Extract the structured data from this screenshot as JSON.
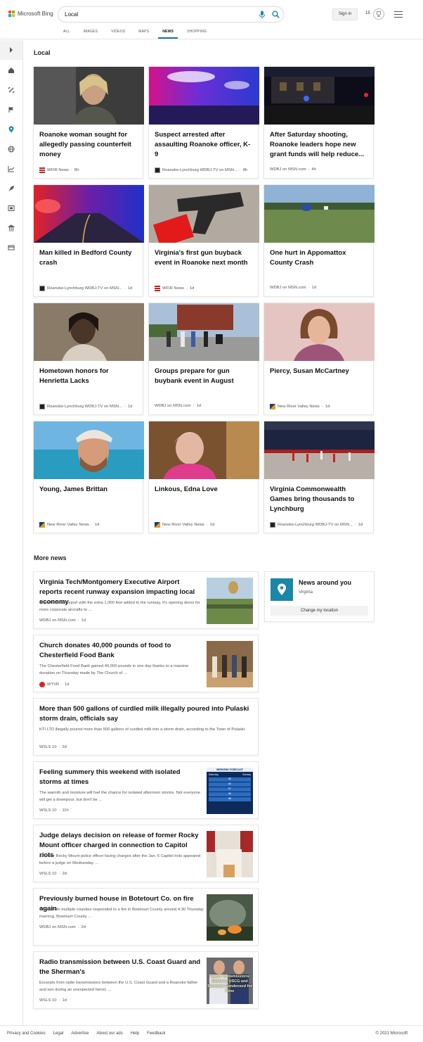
{
  "brand": {
    "name": "Microsoft Bing",
    "logo_colors": [
      "#f25022",
      "#7fba00",
      "#00a4ef",
      "#ffb900"
    ],
    "accent": "#1a87a8"
  },
  "search": {
    "query": "Local",
    "mic_icon": "microphone-icon",
    "search_icon": "magnifier-icon"
  },
  "account": {
    "signin_label": "Sign in",
    "reward_points": "15",
    "reward_icon": "trophy-icon"
  },
  "tabs": [
    {
      "label": "ALL",
      "active": false
    },
    {
      "label": "IMAGES",
      "active": false
    },
    {
      "label": "VIDEOS",
      "active": false
    },
    {
      "label": "MAPS",
      "active": false
    },
    {
      "label": "NEWS",
      "active": true
    },
    {
      "label": "SHOPPING",
      "active": false
    }
  ],
  "sidebar_icons": [
    "chevron-right-icon",
    "home-icon",
    "satellite-icon",
    "flag-icon",
    "location-pin-icon",
    "globe-icon",
    "business-chart-icon",
    "rocket-icon",
    "film-icon",
    "bank-icon",
    "credit-card-icon"
  ],
  "local": {
    "title": "Local",
    "cards": [
      {
        "title": "Roanoke woman sought for allegedly passing counterfeit money",
        "source": "WFIR News",
        "age": "8h"
      },
      {
        "title": "Suspect arrested after assaulting Roanoke officer, K-9",
        "source": "Roanoke-Lynchburg WDBJ-TV on MSN...",
        "age": "8h"
      },
      {
        "title": "After Saturday shooting, Roanoke leaders hope new grant funds will help reduce...",
        "source": "WDBJ on MSN.com",
        "age": "4h"
      },
      {
        "title": "Man killed in Bedford County crash",
        "source": "Roanoke-Lynchburg WDBJ-TV on MSN...",
        "age": "1d"
      },
      {
        "title": "Virginia's first gun buyback event in Roanoke next month",
        "source": "WFIR News",
        "age": "1d"
      },
      {
        "title": "One hurt in Appomattox County Crash",
        "source": "WDBJ on MSN.com",
        "age": "1d"
      },
      {
        "title": "Hometown honors for Henrietta Lacks",
        "source": "Roanoke-Lynchburg WDBJ-TV on MSN...",
        "age": "1d"
      },
      {
        "title": "Groups prepare for gun buybank event in August",
        "source": "WDBJ on MSN.com",
        "age": "1d"
      },
      {
        "title": "Piercy, Susan McCartney",
        "source": "New River Valley News",
        "age": "1d"
      },
      {
        "title": "Young, James Brittan",
        "source": "New River Valley News",
        "age": "1d"
      },
      {
        "title": "Linkous, Edna Love",
        "source": "New River Valley News",
        "age": "1d"
      },
      {
        "title": "Virginia Commonwealth Games bring thousands to Lynchburg",
        "source": "Roanoke-Lynchburg WDBJ-TV on MSN...",
        "age": "1d"
      }
    ]
  },
  "more_news": {
    "title": "More news",
    "items": [
      {
        "title": "Virginia Tech/Montgomery Executive Airport reports recent runway expansion impacting local economy",
        "desc": "Airport officials report with the extra 1,000 feet added to the runway, it's opening doors for more corporate aircrafts to ...",
        "source": "WDBJ on MSN.com",
        "age": "1d"
      },
      {
        "title": "Church donates 40,000 pounds of food to Chesterfield Food Bank",
        "desc": "The Chesterfield Food Bank gained 40,000 pounds in one day thanks to a massive donation on Thursday made by The Church of ...",
        "source": "WTVR",
        "age": "1d"
      },
      {
        "title": "More than 500 gallons of curdled milk illegally poured into Pulaski storm drain, officials say",
        "desc": "KTI LTD illegally poured more than 500 gallons of curdled milk into a storm drain, according to the Town of Pulaski.",
        "source": "WSLS 10",
        "age": "2d"
      },
      {
        "title": "Feeling summery this weekend with isolated storms at times",
        "desc": "The warmth and moisture will fuel the chance for isolated afternoon storms. Not everyone will get a downpour, but don't be ...",
        "source": "WSLS 10",
        "age": "11h"
      },
      {
        "title": "Judge delays decision on release of former Rocky Mount officer charged in connection to Capitol riots",
        "desc": "A former Rocky Mount police officer facing charges after the Jan. 6 Capitol riots appeared before a judge on Wednesday ...",
        "source": "WSLS 10",
        "age": "2d"
      },
      {
        "title": "Previously burned house in Botetourt Co. on fire again",
        "desc": "Crews from multiple counties responded to a fire in Botetourt County around 4:30 Thursday morning. Botetourt County ...",
        "source": "WDBJ on MSN.com",
        "age": "2d"
      },
      {
        "title": "Radio transmission between U.S. Coast Guard and the Sherman's",
        "desc": "Excerpts from radio transmissions between the U.S. Coast Guard and a Roanoke father and son during an unexpected heroic ...",
        "source": "WSLS 10",
        "age": "1d"
      }
    ],
    "weather_thumb": {
      "header": "WEEKEND FORECAST",
      "days": [
        "Saturday",
        "Sunday"
      ],
      "temps": [
        "85",
        "82",
        "87",
        "86",
        "88"
      ]
    },
    "radio_thumb_text": "Radio Transmissions Between USCG and Sherman Condensed for Time"
  },
  "around": {
    "title": "News around you",
    "region": "Virginia",
    "button": "Change my location"
  },
  "footer": {
    "links": [
      "Privacy and Cookies",
      "Legal",
      "Advertise",
      "About our ads",
      "Help",
      "Feedback"
    ],
    "copyright": "© 2021 Microsoft"
  }
}
